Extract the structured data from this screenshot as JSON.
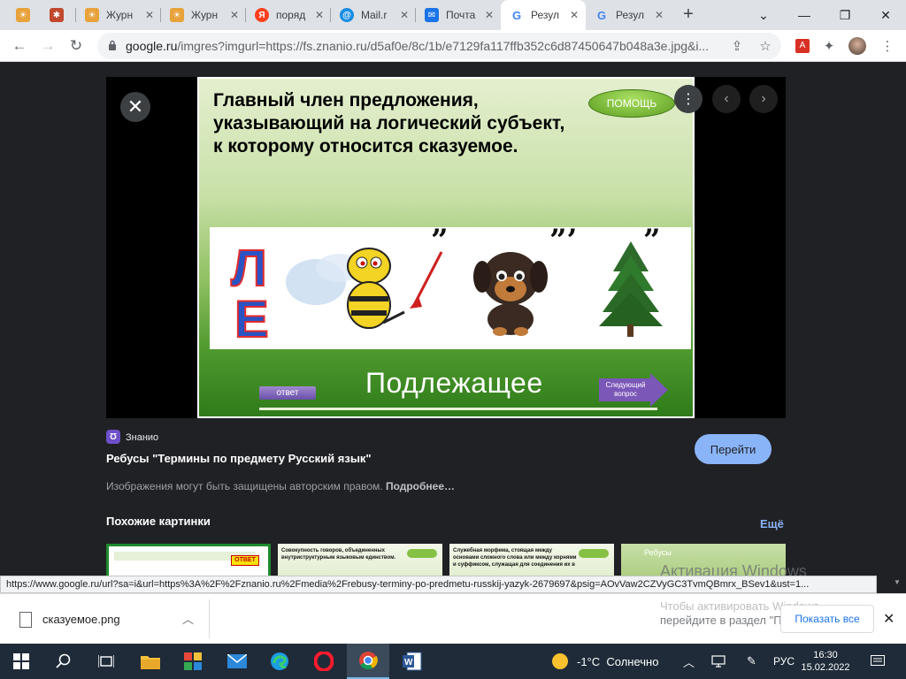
{
  "browser": {
    "tabs": [
      {
        "label": "",
        "favicon": "sun-icon",
        "color": "#e8a23a"
      },
      {
        "label": "",
        "favicon": "puzzle-icon",
        "color": "#c1482d"
      },
      {
        "label": "Журн",
        "favicon": "sun-icon",
        "color": "#e8a23a"
      },
      {
        "label": "Журн",
        "favicon": "sun-icon",
        "color": "#e8a23a"
      },
      {
        "label": "поряд",
        "favicon": "yandex-icon",
        "color": "#fc3f1d"
      },
      {
        "label": "Mail.r",
        "favicon": "mailru-icon",
        "color": "#168de2"
      },
      {
        "label": "Почта",
        "favicon": "mail-icon",
        "color": "#1a73e8"
      },
      {
        "label": "Резул",
        "favicon": "google-icon",
        "color": "#4285f4"
      },
      {
        "label": "Резул",
        "favicon": "google-icon",
        "color": "#4285f4"
      }
    ],
    "active_tab_index": 7,
    "address": {
      "host": "google.ru",
      "path": "/imgres?imgurl=https://fs.znanio.ru/d5af0e/8c/1b/e7129fa117ffb352c6d87450647b048a3e.jpg&i..."
    }
  },
  "viewer": {
    "close_label": "✕",
    "slide": {
      "question": "Главный член предложения, указывающий на логический субъект, к которому относится сказуемое.",
      "help_label": "ПОМОЩЬ",
      "rebus_letters": "Л Е",
      "quote_marks": [
        "”",
        "”’",
        "”"
      ],
      "answer": "Подлежащее",
      "otvet_label": "ответ",
      "next_label": "Следующий вопрос"
    },
    "source_name": "Знанио",
    "title": "Ребусы \"Термины по предмету Русский язык\"",
    "goto_label": "Перейти",
    "copyright": "Изображения могут быть защищены авторским правом.",
    "copyright_more": "Подробнее…",
    "similar_heading": "Похожие картинки",
    "more_label": "Ещё",
    "thumbnails": [
      {
        "text": "",
        "badge": "ОТВЕТ"
      },
      {
        "text": "Совокупность говоров, объединенных внутриструктурным языковым единством.",
        "badge": ""
      },
      {
        "text": "Служебная морфема, стоящая между основами сложного слова или между корнями и суффиксом, служащая для соединения их в",
        "badge": ""
      },
      {
        "text": "Ребусы",
        "badge": ""
      }
    ]
  },
  "status_url": "https://www.google.ru/url?sa=i&url=https%3A%2F%2Fznanio.ru%2Fmedia%2Frebusy-terminy-po-predmetu-russkij-yazyk-2679697&psig=AOvVaw2CZVyGC3TvmQBmrx_BSev1&ust=1...",
  "windows_activation": {
    "line1": "Активация Windows",
    "line2": "Чтобы активировать Windows,",
    "line3": "перейдите в раздел \"Параметры\"."
  },
  "downloads": {
    "file_name": "сказуемое.png",
    "show_all_label": "Показать все"
  },
  "taskbar": {
    "weather": "-1°C  Солнечно",
    "language": "РУС",
    "time": "16:30",
    "date": "15.02.2022"
  }
}
